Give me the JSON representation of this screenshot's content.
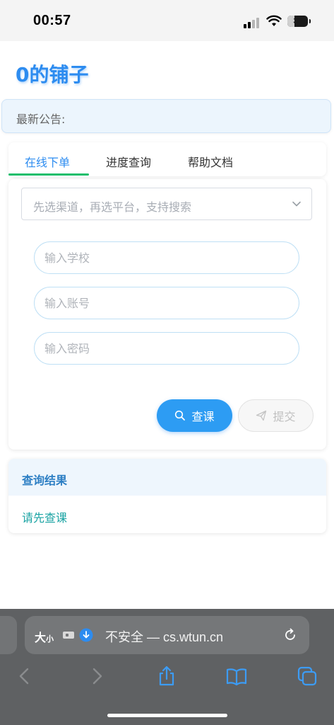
{
  "status_bar": {
    "time": "00:57",
    "battery": "33",
    "battery_level": 0.33
  },
  "site": {
    "title": "0的铺子"
  },
  "notice": {
    "label": "最新公告:"
  },
  "tabs": [
    {
      "label": "在线下单",
      "active": true
    },
    {
      "label": "进度查询",
      "active": false
    },
    {
      "label": "帮助文档",
      "active": false
    }
  ],
  "form": {
    "channel_select_placeholder": "先选渠道，再选平台，支持搜索",
    "school_placeholder": "输入学校",
    "account_placeholder": "输入账号",
    "password_placeholder": "输入密码",
    "query_button": "查课",
    "submit_button": "提交"
  },
  "result": {
    "title": "查询结果",
    "message": "请先查课"
  },
  "browser": {
    "text_size_label": "大",
    "text_size_small": "小",
    "security_label": "不安全 — cs.wtun.cn"
  },
  "colors": {
    "accent": "#2d8cf0",
    "tab_underline": "#19be6b",
    "result_text": "#19a3a3"
  }
}
